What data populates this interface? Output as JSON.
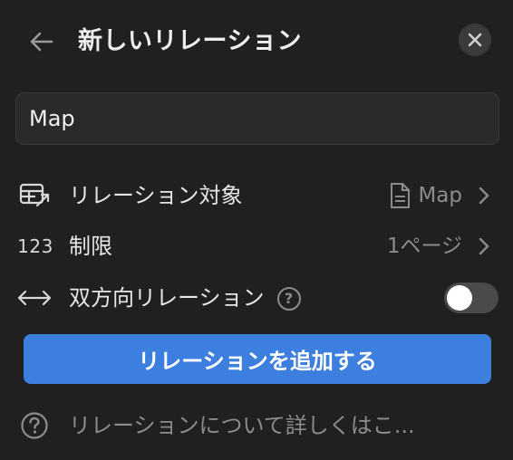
{
  "header": {
    "title": "新しいリレーション",
    "back_icon": "arrow-left-icon",
    "close_icon": "close-icon"
  },
  "name_field": {
    "value": "Map"
  },
  "settings": {
    "relation_target": {
      "label": "リレーション対象",
      "value": "Map",
      "icon": "table-arrow-icon",
      "value_icon": "document-icon"
    },
    "limit": {
      "icon_text": "123",
      "label": "制限",
      "value": "1ページ"
    },
    "two_way": {
      "label": "双方向リレーション",
      "help_text": "?",
      "enabled": false,
      "icon": "bidirectional-arrow-icon"
    }
  },
  "actions": {
    "add_label": "リレーションを追加する"
  },
  "help_link": {
    "text": "リレーションについて詳しくはこ...",
    "icon": "help-circle-icon"
  },
  "colors": {
    "background": "#202020",
    "accent": "#3c7fdf",
    "muted_text": "#8c8c8c",
    "toggle_off": "#4a4a4a"
  }
}
